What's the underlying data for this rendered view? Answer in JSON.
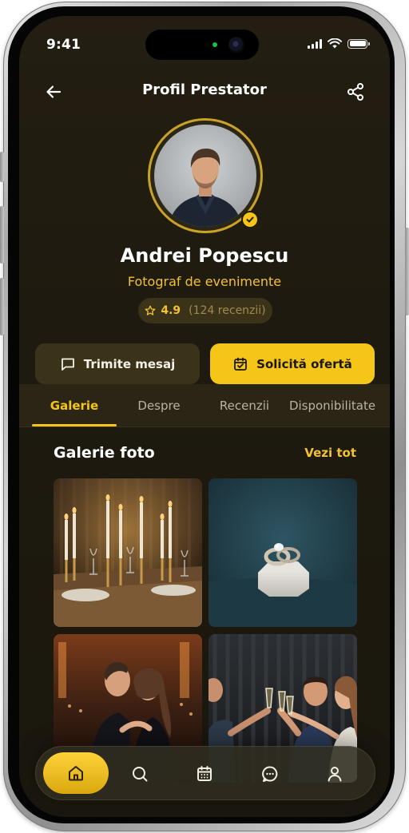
{
  "status_bar": {
    "time": "9:41"
  },
  "header": {
    "title": "Profil Prestator"
  },
  "profile": {
    "name": "Andrei Popescu",
    "role": "Fotograf de evenimente",
    "rating": "4.9",
    "reviews": "(124 recenzii)"
  },
  "actions": {
    "message_label": "Trimite mesaj",
    "offer_label": "Solicită ofertă"
  },
  "tabs": [
    {
      "label": "Galerie",
      "active": true
    },
    {
      "label": "Despre",
      "active": false
    },
    {
      "label": "Recenzii",
      "active": false
    },
    {
      "label": "Disponibilitate",
      "active": false
    }
  ],
  "gallery": {
    "title": "Galerie foto",
    "see_all": "Vezi tot",
    "photos": [
      {
        "subject": "candlelit-table-photo"
      },
      {
        "subject": "wedding-rings-photo"
      },
      {
        "subject": "couple-dancing-photo"
      },
      {
        "subject": "friends-toast-photo"
      }
    ]
  },
  "bottom_nav": {
    "items": [
      {
        "icon": "home-icon",
        "active": true
      },
      {
        "icon": "search-icon",
        "active": false
      },
      {
        "icon": "calendar-icon",
        "active": false
      },
      {
        "icon": "chat-icon",
        "active": false
      },
      {
        "icon": "user-icon",
        "active": false
      }
    ]
  },
  "colors": {
    "accent": "#f5c518",
    "background": "#1e1a0f",
    "surface": "#3a3319"
  }
}
